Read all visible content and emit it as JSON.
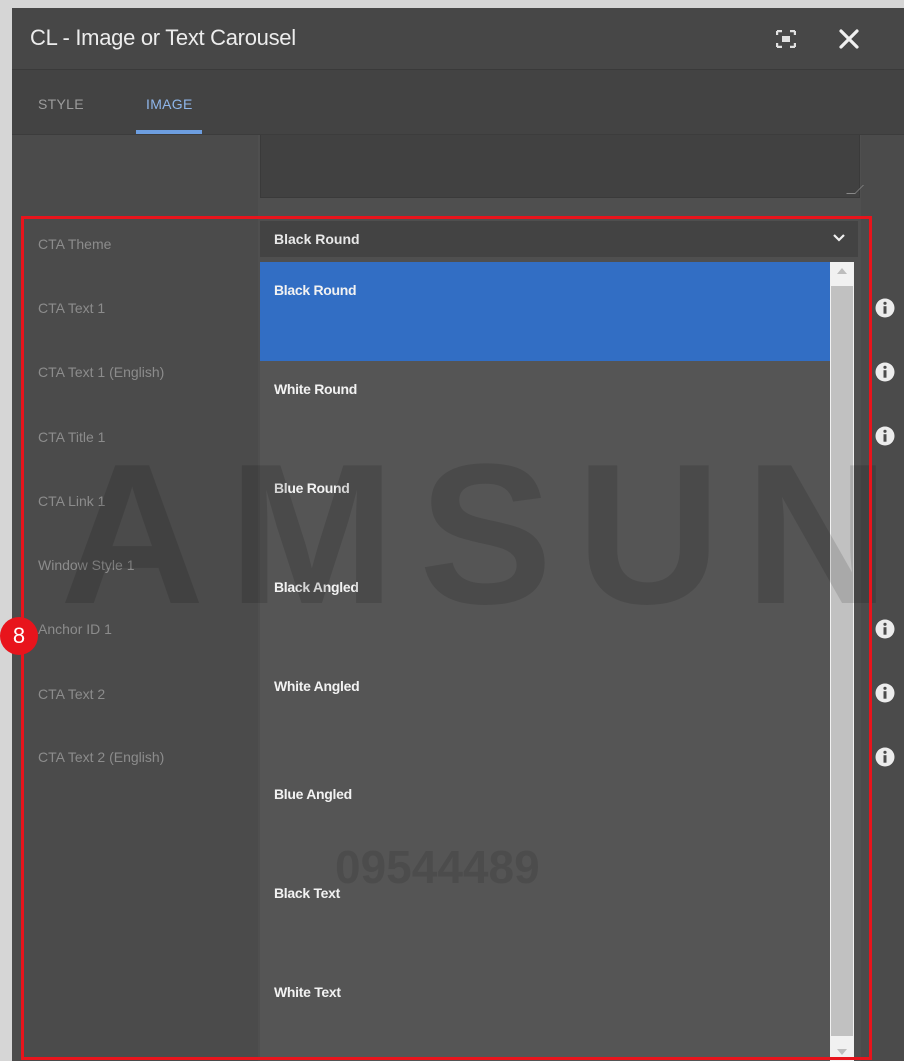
{
  "dialog": {
    "title": "CL - Image or Text Carousel",
    "icons": {
      "fullscreen": "fullscreen-icon",
      "close": "close-icon"
    }
  },
  "tabs": [
    {
      "label": "STYLE",
      "active": false
    },
    {
      "label": "IMAGE",
      "active": true
    }
  ],
  "form": {
    "labels": [
      "CTA Theme",
      "CTA Text 1",
      "CTA Text 1 (English)",
      "CTA Title 1",
      "CTA Link 1",
      "Window Style 1",
      "Anchor ID 1",
      "CTA Text 2",
      "CTA Text 2 (English)"
    ],
    "cta_theme": {
      "value": "Black Round",
      "options": [
        "Black Round",
        "White Round",
        "Blue Round",
        "Black Angled",
        "White Angled",
        "Blue Angled",
        "Black Text",
        "White Text"
      ],
      "selected_index": 0
    }
  },
  "annotation": {
    "step_number": "8",
    "color": "#e8141c"
  },
  "watermark": {
    "brand": "AMSUN",
    "number": "09544489"
  },
  "colors": {
    "accent": "#326ec4",
    "tab_active": "#8fb6ea",
    "highlight": "#e8141c"
  }
}
